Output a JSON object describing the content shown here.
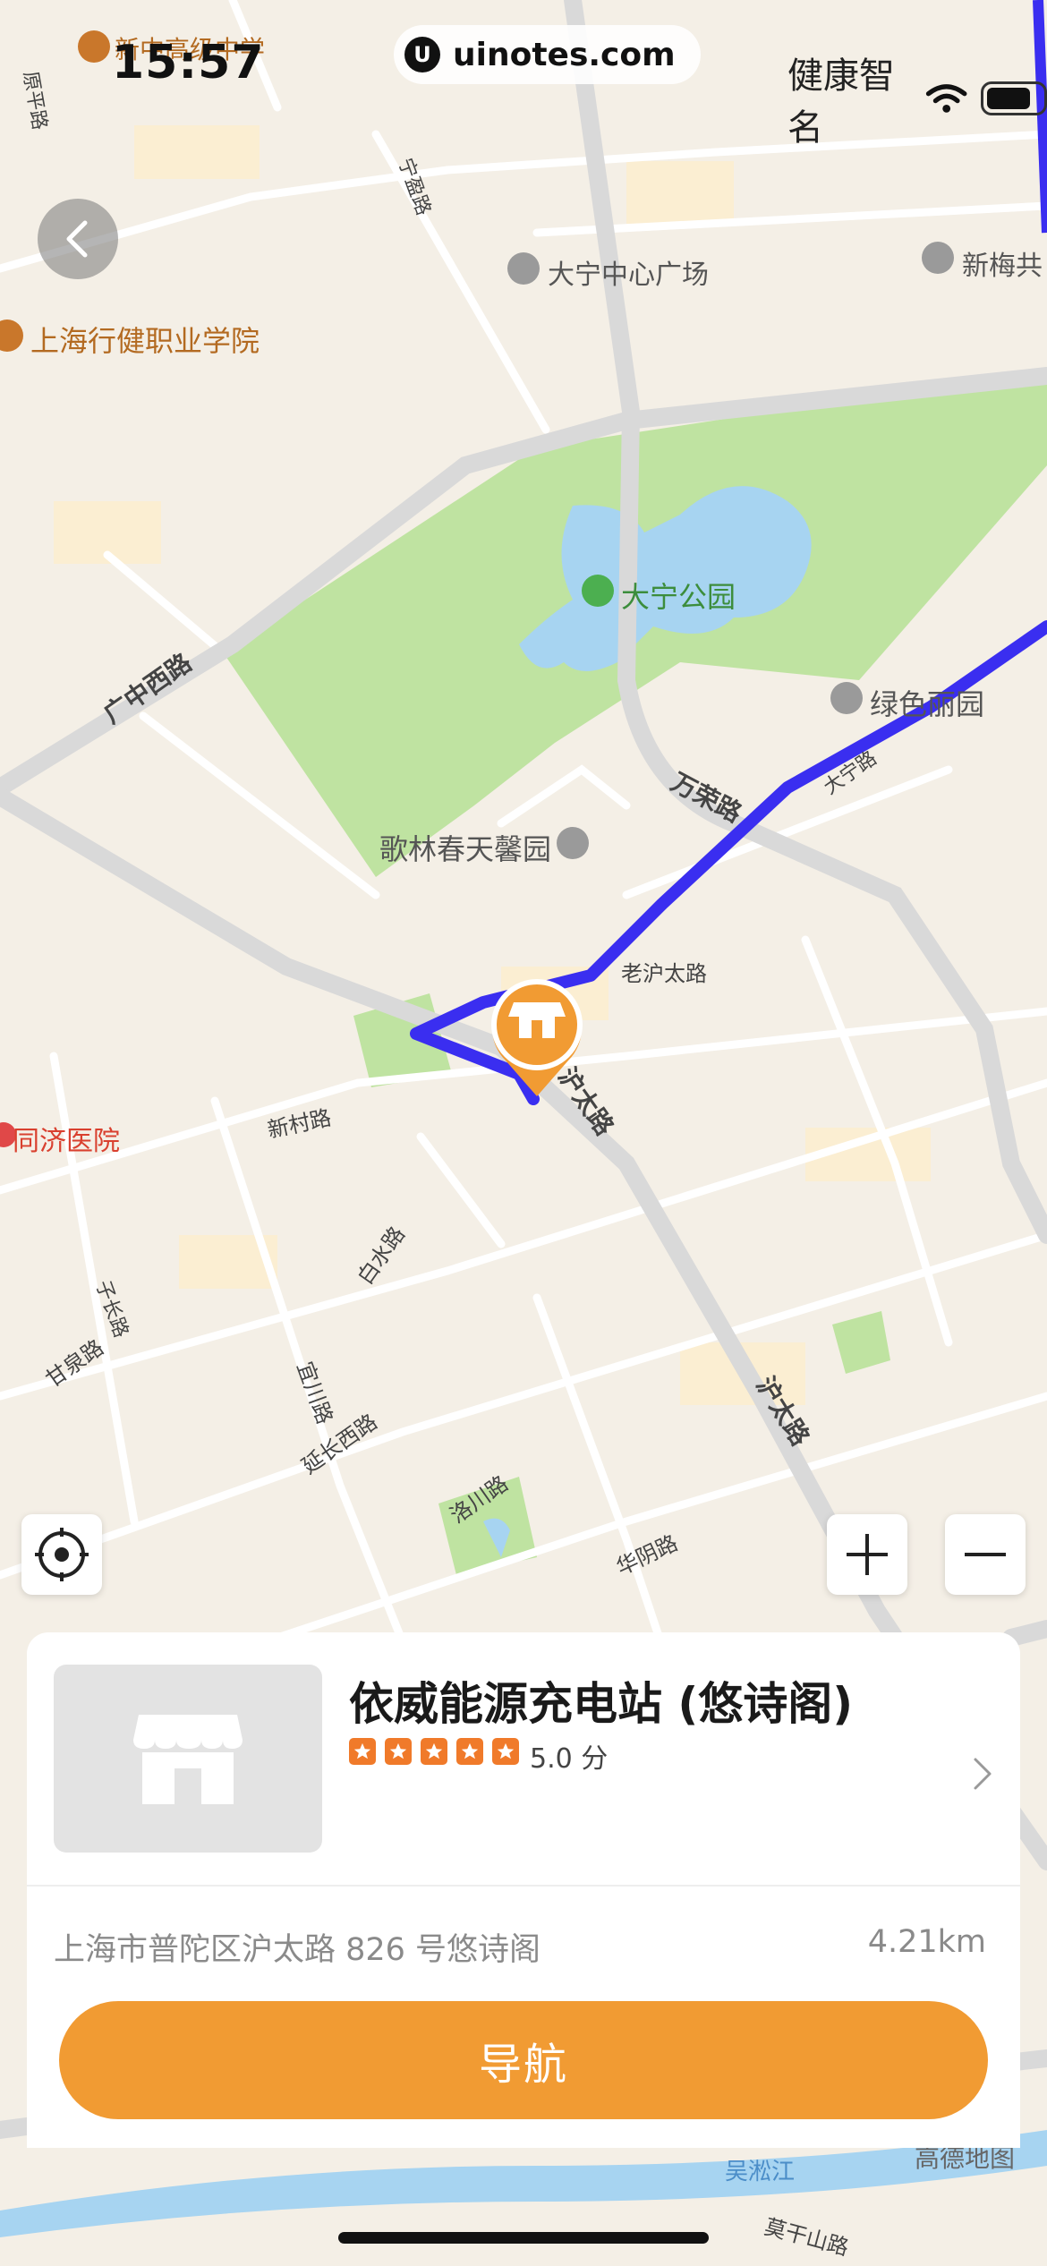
{
  "status_bar": {
    "time": "15:57",
    "watermark": "uinotes.com",
    "watermark_logo": "U",
    "right_text": "健康智名"
  },
  "map": {
    "route_color": "#3a2ef0",
    "park_color": "#bfe3a1",
    "water_color": "#a7d4f1",
    "marker_color": "#f19b33",
    "labels": {
      "school": "新中高级中学",
      "college": "上海行健职业学院",
      "mall": "大宁中心广场",
      "park": "大宁公园",
      "community": "绿色丽园",
      "xinmei": "新梅共",
      "gelin": "歌林春天馨园",
      "hospital": "同济医院",
      "guangzhong": "广中西路",
      "wanrong": "万荣路",
      "daning_road": "大宁路",
      "laohutai": "老沪太路",
      "hutai1": "沪太路",
      "hutai2": "沪太路",
      "xincun": "新村路",
      "baishui": "白水路",
      "zichang": "子长路",
      "ganquan": "甘泉路",
      "yichuan": "宜川路",
      "yanchang": "延长西路",
      "luochuan": "洛川路",
      "huayin": "华阴路",
      "ningling": "宁盈路",
      "yuanping": "原平路",
      "wusong": "吴淞江",
      "moganshan": "莫干山路",
      "gaode": "高德地图"
    }
  },
  "card": {
    "station_name": "依威能源充电站 (悠诗阁)",
    "rating_text": "5.0 分",
    "stars": 5,
    "address": "上海市普陀区沪太路 826 号悠诗阁",
    "distance": "4.21km",
    "nav_button": "导航"
  },
  "icons": {
    "back": "back-arrow-icon",
    "locate": "locate-icon",
    "zoom_in": "plus-icon",
    "zoom_out": "minus-icon",
    "marker": "shop-marker-icon",
    "thumb": "shop-icon"
  }
}
